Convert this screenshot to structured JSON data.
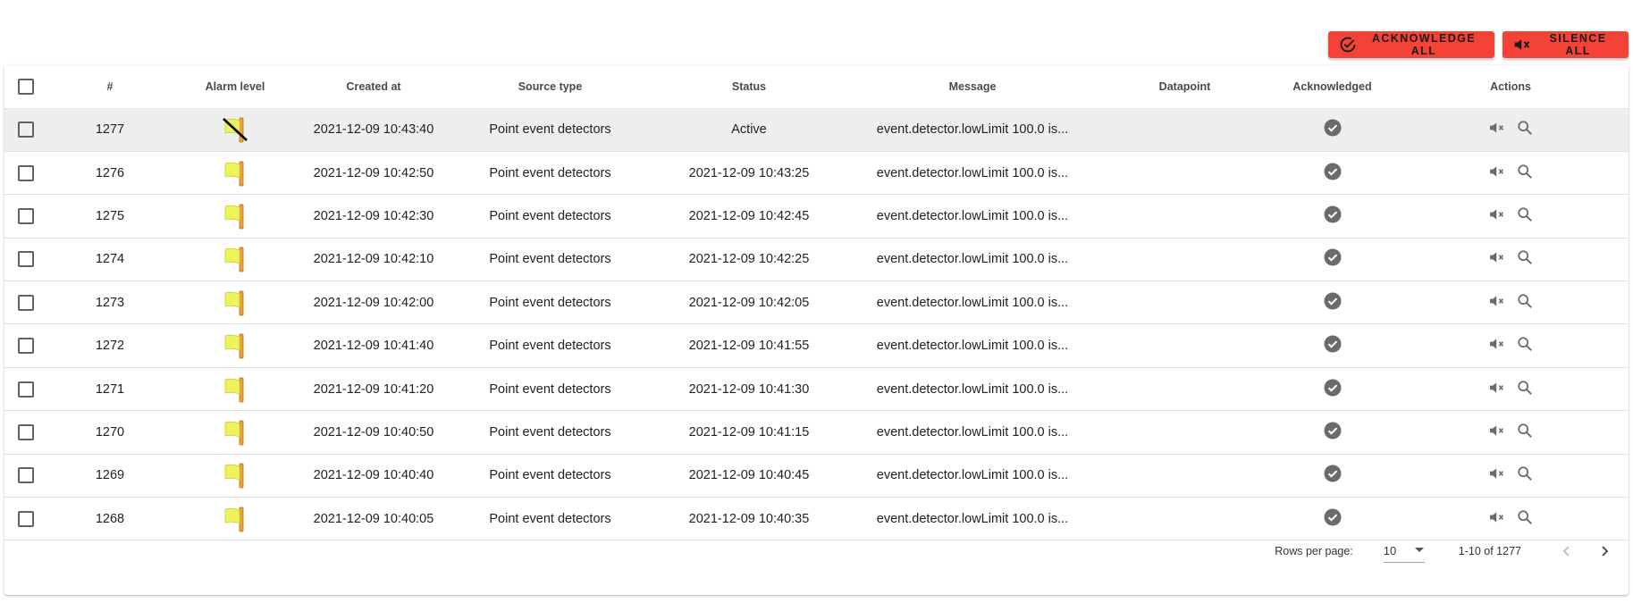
{
  "toolbar": {
    "acknowledge_all": "Acknowledge all",
    "silence_all": "Silence all",
    "accent": "#f44336"
  },
  "table": {
    "columns": [
      "#",
      "Alarm level",
      "Created at",
      "Source type",
      "Status",
      "Message",
      "Datapoint",
      "Acknowledged",
      "Actions"
    ],
    "rows": [
      {
        "id": "1277",
        "created": "2021-12-09 10:43:40",
        "source": "Point event detectors",
        "status": "Active",
        "message": "event.detector.lowLimit 100.0 is...",
        "datapoint": "",
        "alarm_icon": "flag-muted-icon"
      },
      {
        "id": "1276",
        "created": "2021-12-09 10:42:50",
        "source": "Point event detectors",
        "status": "2021-12-09 10:43:25",
        "message": "event.detector.lowLimit 100.0 is...",
        "datapoint": "",
        "alarm_icon": "flag-icon"
      },
      {
        "id": "1275",
        "created": "2021-12-09 10:42:30",
        "source": "Point event detectors",
        "status": "2021-12-09 10:42:45",
        "message": "event.detector.lowLimit 100.0 is...",
        "datapoint": "",
        "alarm_icon": "flag-icon"
      },
      {
        "id": "1274",
        "created": "2021-12-09 10:42:10",
        "source": "Point event detectors",
        "status": "2021-12-09 10:42:25",
        "message": "event.detector.lowLimit 100.0 is...",
        "datapoint": "",
        "alarm_icon": "flag-icon"
      },
      {
        "id": "1273",
        "created": "2021-12-09 10:42:00",
        "source": "Point event detectors",
        "status": "2021-12-09 10:42:05",
        "message": "event.detector.lowLimit 100.0 is...",
        "datapoint": "",
        "alarm_icon": "flag-icon"
      },
      {
        "id": "1272",
        "created": "2021-12-09 10:41:40",
        "source": "Point event detectors",
        "status": "2021-12-09 10:41:55",
        "message": "event.detector.lowLimit 100.0 is...",
        "datapoint": "",
        "alarm_icon": "flag-icon"
      },
      {
        "id": "1271",
        "created": "2021-12-09 10:41:20",
        "source": "Point event detectors",
        "status": "2021-12-09 10:41:30",
        "message": "event.detector.lowLimit 100.0 is...",
        "datapoint": "",
        "alarm_icon": "flag-icon"
      },
      {
        "id": "1270",
        "created": "2021-12-09 10:40:50",
        "source": "Point event detectors",
        "status": "2021-12-09 10:41:15",
        "message": "event.detector.lowLimit 100.0 is...",
        "datapoint": "",
        "alarm_icon": "flag-icon"
      },
      {
        "id": "1269",
        "created": "2021-12-09 10:40:40",
        "source": "Point event detectors",
        "status": "2021-12-09 10:40:45",
        "message": "event.detector.lowLimit 100.0 is...",
        "datapoint": "",
        "alarm_icon": "flag-icon"
      },
      {
        "id": "1268",
        "created": "2021-12-09 10:40:05",
        "source": "Point event detectors",
        "status": "2021-12-09 10:40:35",
        "message": "event.detector.lowLimit 100.0 is...",
        "datapoint": "",
        "alarm_icon": "flag-icon"
      }
    ]
  },
  "pagination": {
    "rows_per_page_label": "Rows per page:",
    "rows_per_page_value": "10",
    "range": "1-10 of 1277"
  }
}
